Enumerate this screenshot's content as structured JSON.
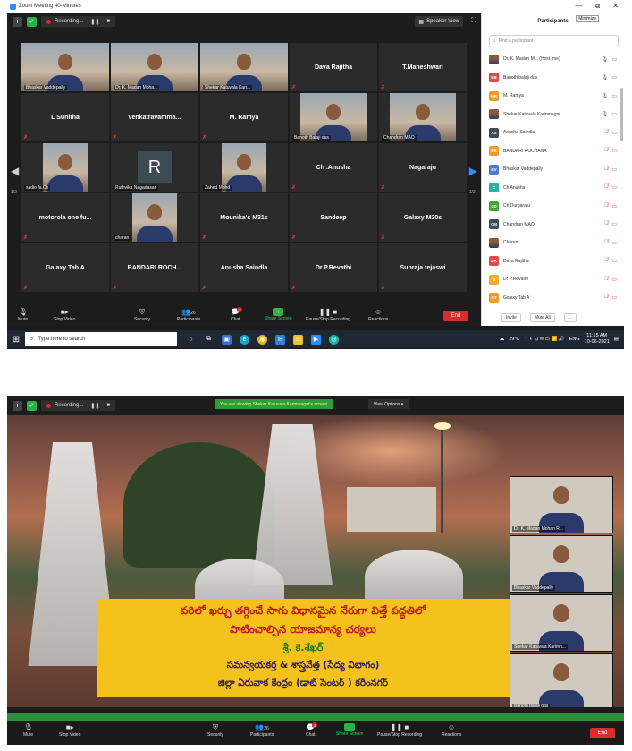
{
  "window": {
    "title": "Zoom Meeting 40-Minutes",
    "controls": [
      "—",
      "⧉",
      "✕"
    ]
  },
  "shot1": {
    "recording_label": "Recording...",
    "speaker_view_label": "Speaker View",
    "grid": [
      {
        "name": "Bhaskar Vaddepally",
        "type": "video",
        "active": false
      },
      {
        "name": "Dr. K. Madan Moha...",
        "type": "video",
        "active": false
      },
      {
        "name": "Shekar Katuvala Kari...",
        "type": "video",
        "active": true
      },
      {
        "name": "Dava Rajitha",
        "type": "label"
      },
      {
        "name": "T.Maheshwari",
        "type": "label"
      },
      {
        "name": "L Sunitha",
        "type": "label"
      },
      {
        "name": "venkatravamma...",
        "type": "label"
      },
      {
        "name": "M. Ramya",
        "type": "label"
      },
      {
        "name": "Banoth Balaji das",
        "type": "video-wide"
      },
      {
        "name": "Chandran MAO",
        "type": "video-wide"
      },
      {
        "name": "sadio fa.Ch",
        "type": "video-narrow"
      },
      {
        "name": "Ruthvika Nagadasari",
        "type": "avatar",
        "letter": "R"
      },
      {
        "name": "Zahed Mohd",
        "type": "video-narrow"
      },
      {
        "name": "Ch .Anusha",
        "type": "label"
      },
      {
        "name": "Nagaraju",
        "type": "label"
      },
      {
        "name": "motorola one fu...",
        "type": "label"
      },
      {
        "name": "charan",
        "type": "video-narrow"
      },
      {
        "name": "Mounika's M31s",
        "type": "label"
      },
      {
        "name": "Sandeep",
        "type": "label"
      },
      {
        "name": "Galaxy M30s",
        "type": "label"
      },
      {
        "name": "Galaxy Tab A",
        "type": "label"
      },
      {
        "name": "BANDARI ROCH...",
        "type": "label"
      },
      {
        "name": "Anusha Saindla",
        "type": "label"
      },
      {
        "name": "Dr.P.Revathi",
        "type": "label"
      },
      {
        "name": "Supraja tejaswi",
        "type": "label"
      }
    ],
    "pager_left": "1/2",
    "pager_right": "1/2",
    "toolbar": {
      "mute": "Mute",
      "stop_video": "Stop Video",
      "security": "Security",
      "participants": "Participants",
      "participants_count": "26",
      "chat": "Chat",
      "chat_badge": "2",
      "share_screen": "Share Screen",
      "pause_recording": "Pause/Stop Recording",
      "reactions": "Reactions",
      "end": "End"
    },
    "panel": {
      "title": "Participants",
      "minimize_tooltip": "Minimize",
      "search_placeholder": "Find a participant",
      "rows": [
        {
          "initials": "",
          "name": "Dr. K. Madan M... (Host, me)",
          "color": "photo",
          "mic": "on",
          "cam": "on"
        },
        {
          "initials": "BB",
          "name": "Banoth balaji das",
          "color": "#e04a4a",
          "mic": "on",
          "cam": "on"
        },
        {
          "initials": "MR",
          "name": "M. Ramya",
          "color": "#f29b2a",
          "mic": "on",
          "cam": "off"
        },
        {
          "initials": "",
          "name": "Shekar Katuvala Karimnagar",
          "color": "photo",
          "mic": "on",
          "cam": "on"
        },
        {
          "initials": "AS",
          "name": "Anusha Saindla",
          "color": "#3d4b52",
          "mic": "off",
          "cam": "off"
        },
        {
          "initials": "BR",
          "name": "BANDARI ROCHANA",
          "color": "#f29b2a",
          "mic": "off",
          "cam": "off"
        },
        {
          "initials": "BV",
          "name": "Bhaskar Vaddepally",
          "color": "#4a7bd0",
          "mic": "off",
          "cam": "on"
        },
        {
          "initials": "C",
          "name": "Ch Anusha",
          "color": "#27b4a0",
          "mic": "off",
          "cam": "off"
        },
        {
          "initials": "CD",
          "name": "Ch Durgaraju",
          "color": "#3aa53a",
          "mic": "off",
          "cam": "off"
        },
        {
          "initials": "CM",
          "name": "Chandran MAO",
          "color": "#3d4b52",
          "mic": "off",
          "cam": "on"
        },
        {
          "initials": "",
          "name": "Charan",
          "color": "photo",
          "mic": "off",
          "cam": "on"
        },
        {
          "initials": "DR",
          "name": "Dava Rajitha",
          "color": "#e04a4a",
          "mic": "off",
          "cam": "off"
        },
        {
          "initials": "D",
          "name": "Dr P.Revathi",
          "color": "#f2b02a",
          "mic": "off",
          "cam": "off"
        },
        {
          "initials": "GT",
          "name": "Galaxy Tab A",
          "color": "#f29b2a",
          "mic": "off",
          "cam": "off"
        }
      ],
      "invite": "Invite",
      "mute_all": "Mute All",
      "more": "..."
    },
    "taskbar": {
      "search_placeholder": "Type here to search",
      "weather": "29°C",
      "lang": "ENG",
      "time": "11:15 AM",
      "date": "10-06-2021"
    }
  },
  "shot2": {
    "recording_label": "Recording...",
    "viewing_text": "You are viewing Shekar Katuvala Karimnagar's screen",
    "view_options": "View Options",
    "slide": {
      "line1": "వరిలో ఖర్చు తగ్గించే సాగు విధానమైన నేరుగా విత్తే పద్ధతిలో",
      "line2": "పాటించాల్సిన యాజమాన్య చర్యలు",
      "line3": "శ్రీ. కె.శేఖర్",
      "line4": "సమన్వయకర్త & శాస్త్రవేత్త (సేద్య విభాగం)",
      "line5": "జిల్లా ఏరువాక కేంద్రం (డాట్ సెంటర్ ) కరీంనగర్"
    },
    "side_videos": [
      {
        "name": "Dr. K. Madan Mohan R..."
      },
      {
        "name": "Bhaskar Vaddepally"
      },
      {
        "name": "Shekar Katuvala Karimn..."
      },
      {
        "name": "Banoth balaji das"
      }
    ],
    "toolbar": {
      "mute": "Mute",
      "stop_video": "Stop Video",
      "security": "Security",
      "participants": "Participants",
      "participants_count": "26",
      "chat": "Chat",
      "chat_badge": "2",
      "share_screen": "Share Screen",
      "pause_recording": "Pause/Stop Recording",
      "reactions": "Reactions",
      "end": "End"
    }
  }
}
